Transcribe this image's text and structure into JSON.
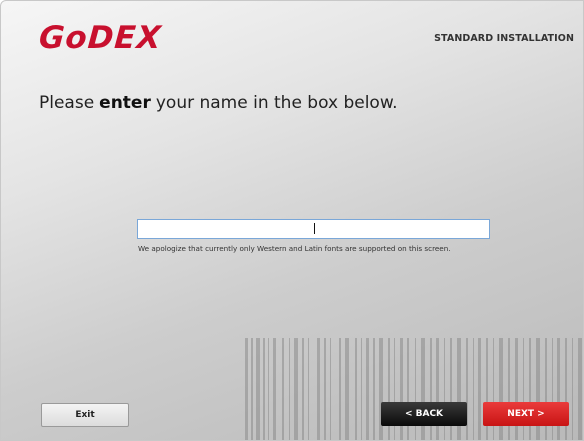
{
  "header": {
    "logo_text": "GoDEX",
    "installation_label": "STANDARD INSTALLATION"
  },
  "prompt": {
    "before": "Please",
    "emphasis": "enter",
    "after": "your name in the box below."
  },
  "name_field": {
    "value": "",
    "placeholder": ""
  },
  "note": "We apologize that currently only Western and Latin fonts are supported on this screen.",
  "buttons": {
    "exit": "Exit",
    "back": "< BACK",
    "next": "NEXT >"
  },
  "colors": {
    "brand_red": "#c8102e",
    "next_button": "#d61f1f",
    "back_button": "#111111",
    "input_border": "#7aa7d8"
  }
}
